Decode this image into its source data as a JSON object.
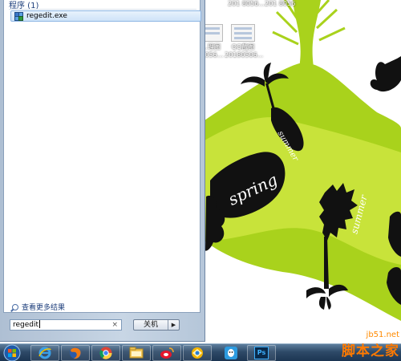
{
  "start_menu": {
    "section_header": "程序 (1)",
    "result_item": "regedit.exe",
    "see_more": "查看更多结果",
    "search_value": "regedit",
    "clear_glyph": "×",
    "shutdown_label": "关机",
    "shutdown_arrow": "▶"
  },
  "desktop": {
    "top_labels": [
      "201 8056...",
      "201 8056"
    ],
    "icons": [
      {
        "label": "…理图",
        "sub": "…056…"
      },
      {
        "label": "QQ截图",
        "sub": "20180506..."
      }
    ],
    "wallpaper_words": [
      "spring",
      "summer",
      "summer"
    ]
  },
  "taskbar": {
    "apps": [
      {
        "name": "internet-explorer"
      },
      {
        "name": "firefox"
      },
      {
        "name": "chrome"
      },
      {
        "name": "file-explorer"
      },
      {
        "name": "weibo"
      },
      {
        "name": "qq-browser"
      },
      {
        "name": "qq-app"
      },
      {
        "name": "photoshop",
        "text": "Ps"
      }
    ]
  },
  "watermark": {
    "site": "jb51.net",
    "brand": "脚本之家"
  },
  "colors": {
    "wallpaper_green": "#a9d21c",
    "silhouette": "#111111",
    "start_menu_blue": "#c8d6e5",
    "taskbar_blue": "#2e4a68",
    "watermark_orange": "#ff7a00"
  }
}
